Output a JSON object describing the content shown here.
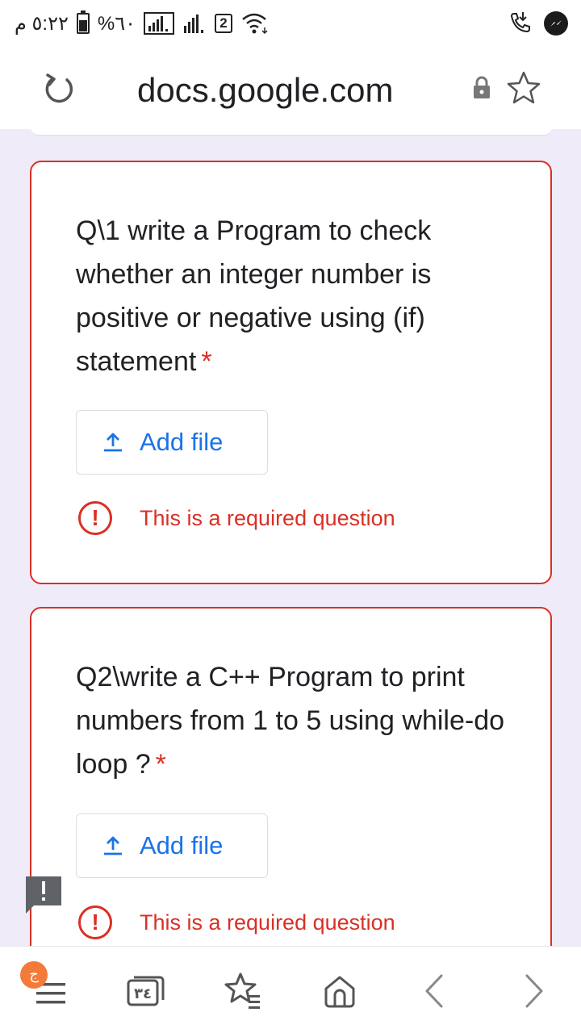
{
  "status_bar": {
    "time": "٥:٢٢ م",
    "battery_percent": "%٦٠",
    "sim_badge": "2",
    "icons": [
      "battery-icon",
      "signal-icon",
      "signal-icon",
      "wifi-icon",
      "call-icon",
      "messenger-icon"
    ]
  },
  "browser": {
    "url": "docs.google.com",
    "icons": [
      "reload-icon",
      "lock-icon",
      "bookmark-star-icon"
    ]
  },
  "questions": [
    {
      "title": "Q\\1 write a Program to check whether an integer number is positive or negative using (if) statement",
      "required_mark": "*",
      "add_file_label": "Add file",
      "error_text": "This is a required question"
    },
    {
      "title": "Q2\\write a C++ Program to print numbers from 1 to 5 using while-do loop ?",
      "required_mark": "*",
      "add_file_label": "Add file",
      "error_text": "This is a required question"
    }
  ],
  "bottom_bar": {
    "menu_badge": "ج",
    "tabs_count": "٣٤",
    "icons": [
      "menu-icon",
      "tabs-icon",
      "bookmarks-icon",
      "home-icon",
      "back-icon",
      "forward-icon"
    ]
  },
  "colors": {
    "form_background": "#f0ebf8",
    "error_red": "#d93025",
    "link_blue": "#1a73e8"
  }
}
